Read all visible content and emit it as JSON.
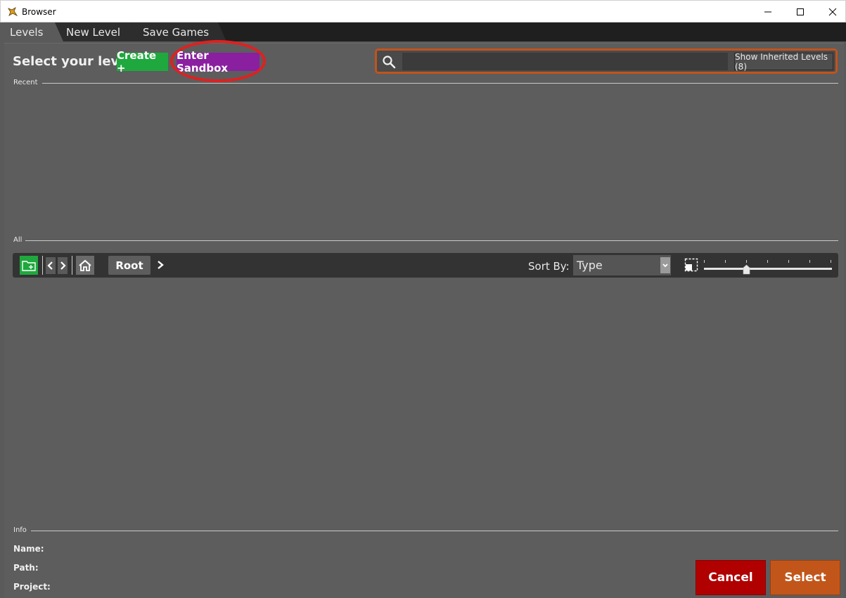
{
  "window": {
    "title": "Browser",
    "controls": [
      "minimize",
      "maximize",
      "close"
    ]
  },
  "tabs": [
    {
      "label": "Levels",
      "active": true
    },
    {
      "label": "New Level",
      "active": false
    },
    {
      "label": "Save Games",
      "active": false
    }
  ],
  "header": {
    "title": "Select your level",
    "create_label": "Create +",
    "sandbox_label": "Enter Sandbox"
  },
  "search": {
    "value": "",
    "placeholder": "",
    "inherited_label": "Show Inherited Levels (8)"
  },
  "sections": {
    "recent": "Recent",
    "all": "All",
    "info": "Info"
  },
  "toolbar": {
    "root_label": "Root",
    "sort_label": "Sort By:",
    "sort_value": "Type",
    "zoom_fraction": 0.33
  },
  "info": {
    "name_label": "Name:",
    "path_label": "Path:",
    "project_label": "Project:"
  },
  "actions": {
    "cancel_label": "Cancel",
    "select_label": "Select"
  },
  "colors": {
    "create": "#1fa83e",
    "sandbox": "#8a1fa0",
    "search_border": "#c2541c",
    "cancel": "#b00000",
    "select": "#c2561a",
    "annotation": "#e02020"
  }
}
